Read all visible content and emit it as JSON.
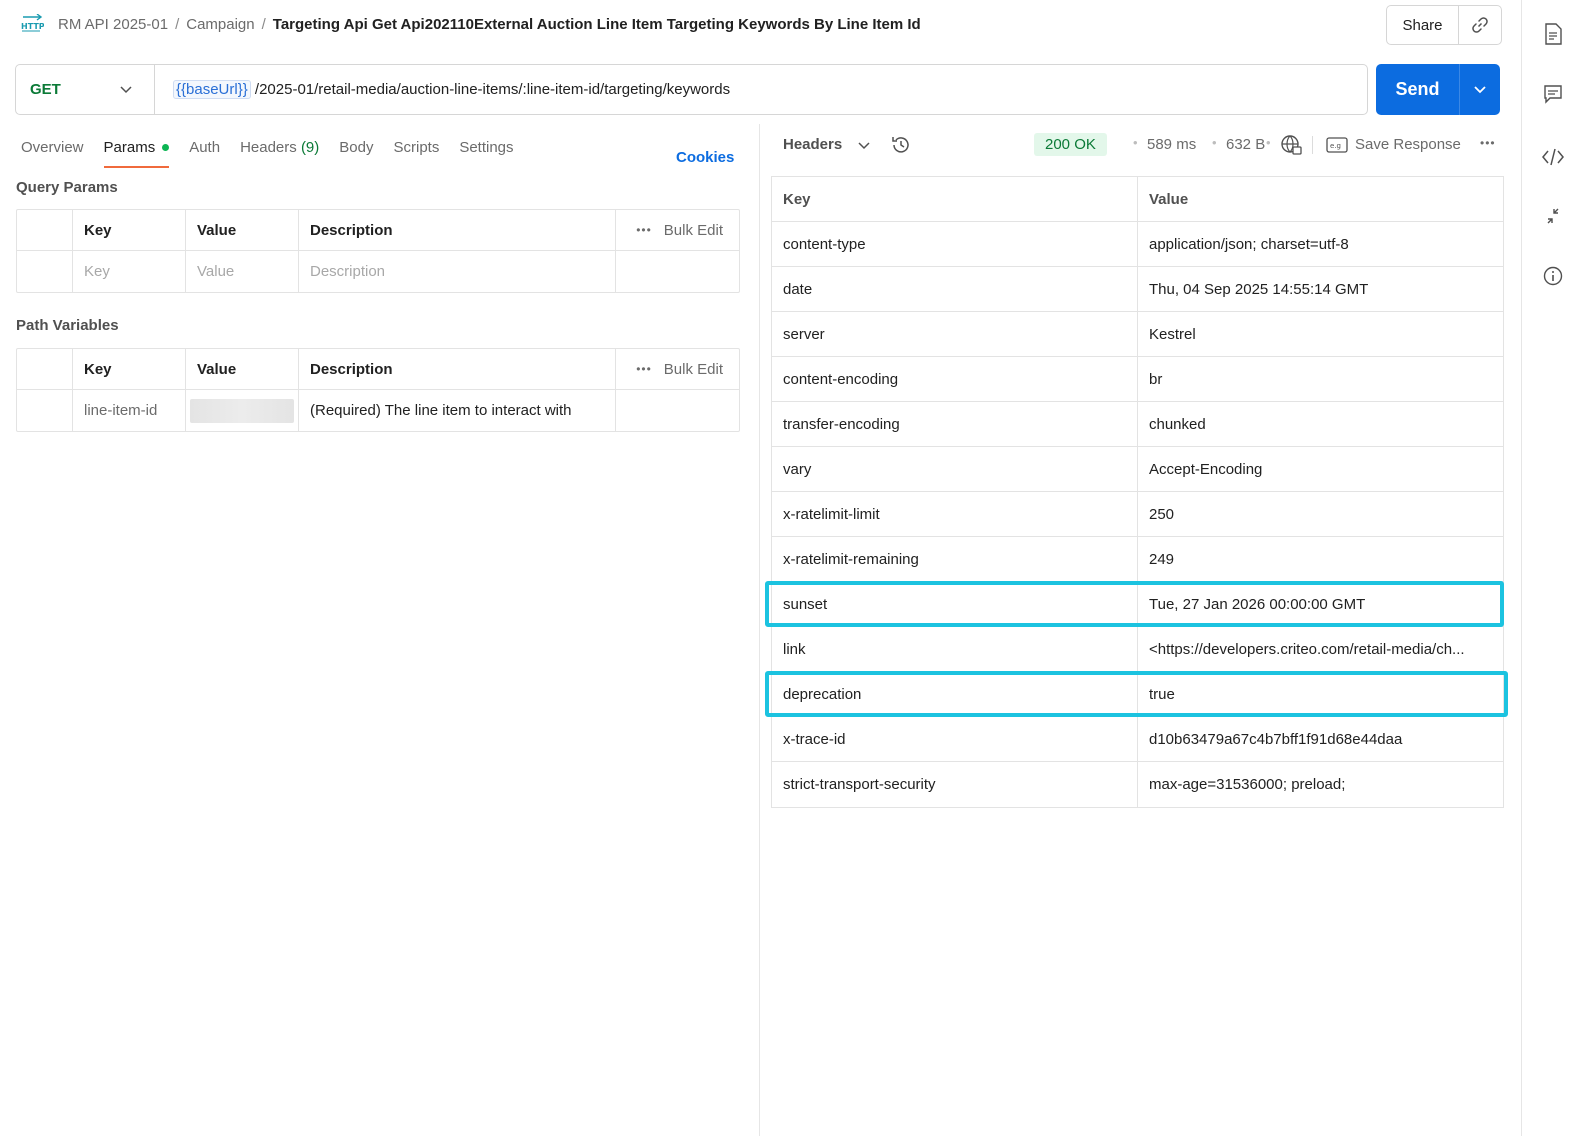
{
  "breadcrumb": {
    "items": [
      "RM API 2025-01",
      "Campaign"
    ],
    "separator": "/",
    "current": "Targeting Api Get Api202110External Auction Line Item Targeting Keywords By Line Item Id"
  },
  "header": {
    "share_label": "Share"
  },
  "request": {
    "method": "GET",
    "url_variable": "{{baseUrl}}",
    "url_path": "/2025-01/retail-media/auction-line-items/:line-item-id/targeting/keywords",
    "send_label": "Send"
  },
  "tabs": [
    {
      "label": "Overview"
    },
    {
      "label": "Params",
      "active": true
    },
    {
      "label": "Auth"
    },
    {
      "label": "Headers",
      "count": "(9)"
    },
    {
      "label": "Body"
    },
    {
      "label": "Scripts"
    },
    {
      "label": "Settings"
    }
  ],
  "cookies_label": "Cookies",
  "query_params": {
    "title": "Query Params",
    "columns": [
      "Key",
      "Value",
      "Description"
    ],
    "bulk_edit": "Bulk Edit",
    "placeholder_row": {
      "key": "Key",
      "value": "Value",
      "description": "Description"
    }
  },
  "path_variables": {
    "title": "Path Variables",
    "columns": [
      "Key",
      "Value",
      "Description"
    ],
    "bulk_edit": "Bulk Edit",
    "rows": [
      {
        "key": "line-item-id",
        "value": "",
        "description": "(Required) The line item to interact with"
      }
    ]
  },
  "response": {
    "view_label": "Headers",
    "status": "200 OK",
    "time": "589 ms",
    "size": "632 B",
    "save_label": "Save Response",
    "columns": [
      "Key",
      "Value"
    ],
    "headers": [
      {
        "key": "content-type",
        "value": "application/json; charset=utf-8"
      },
      {
        "key": "date",
        "value": "Thu, 04 Sep 2025 14:55:14 GMT"
      },
      {
        "key": "server",
        "value": "Kestrel"
      },
      {
        "key": "content-encoding",
        "value": "br"
      },
      {
        "key": "transfer-encoding",
        "value": "chunked"
      },
      {
        "key": "vary",
        "value": "Accept-Encoding"
      },
      {
        "key": "x-ratelimit-limit",
        "value": "250"
      },
      {
        "key": "x-ratelimit-remaining",
        "value": "249"
      },
      {
        "key": "sunset",
        "value": "Tue, 27 Jan 2026 00:00:00 GMT",
        "highlighted": true
      },
      {
        "key": "link",
        "value": "<https://developers.criteo.com/retail-media/ch..."
      },
      {
        "key": "deprecation",
        "value": "true",
        "highlighted": true
      },
      {
        "key": "x-trace-id",
        "value": "d10b63479a67c4b7bff1f91d68e44daa"
      },
      {
        "key": "strict-transport-security",
        "value": "max-age=31536000; preload;"
      }
    ]
  },
  "colors": {
    "accent": "#0c6ce0",
    "method_green": "#0b7a37",
    "tab_underline": "#f06a3c",
    "highlight": "#1cc3e0",
    "status_bg": "#e3f7ea"
  },
  "icons": {
    "http": "http-icon",
    "link": "link-icon",
    "rail": [
      "document-icon",
      "comment-icon",
      "code-icon",
      "collapse-icon",
      "info-icon"
    ],
    "history": "history-icon",
    "globe": "globe-lock-icon",
    "save": "save-example-icon"
  }
}
